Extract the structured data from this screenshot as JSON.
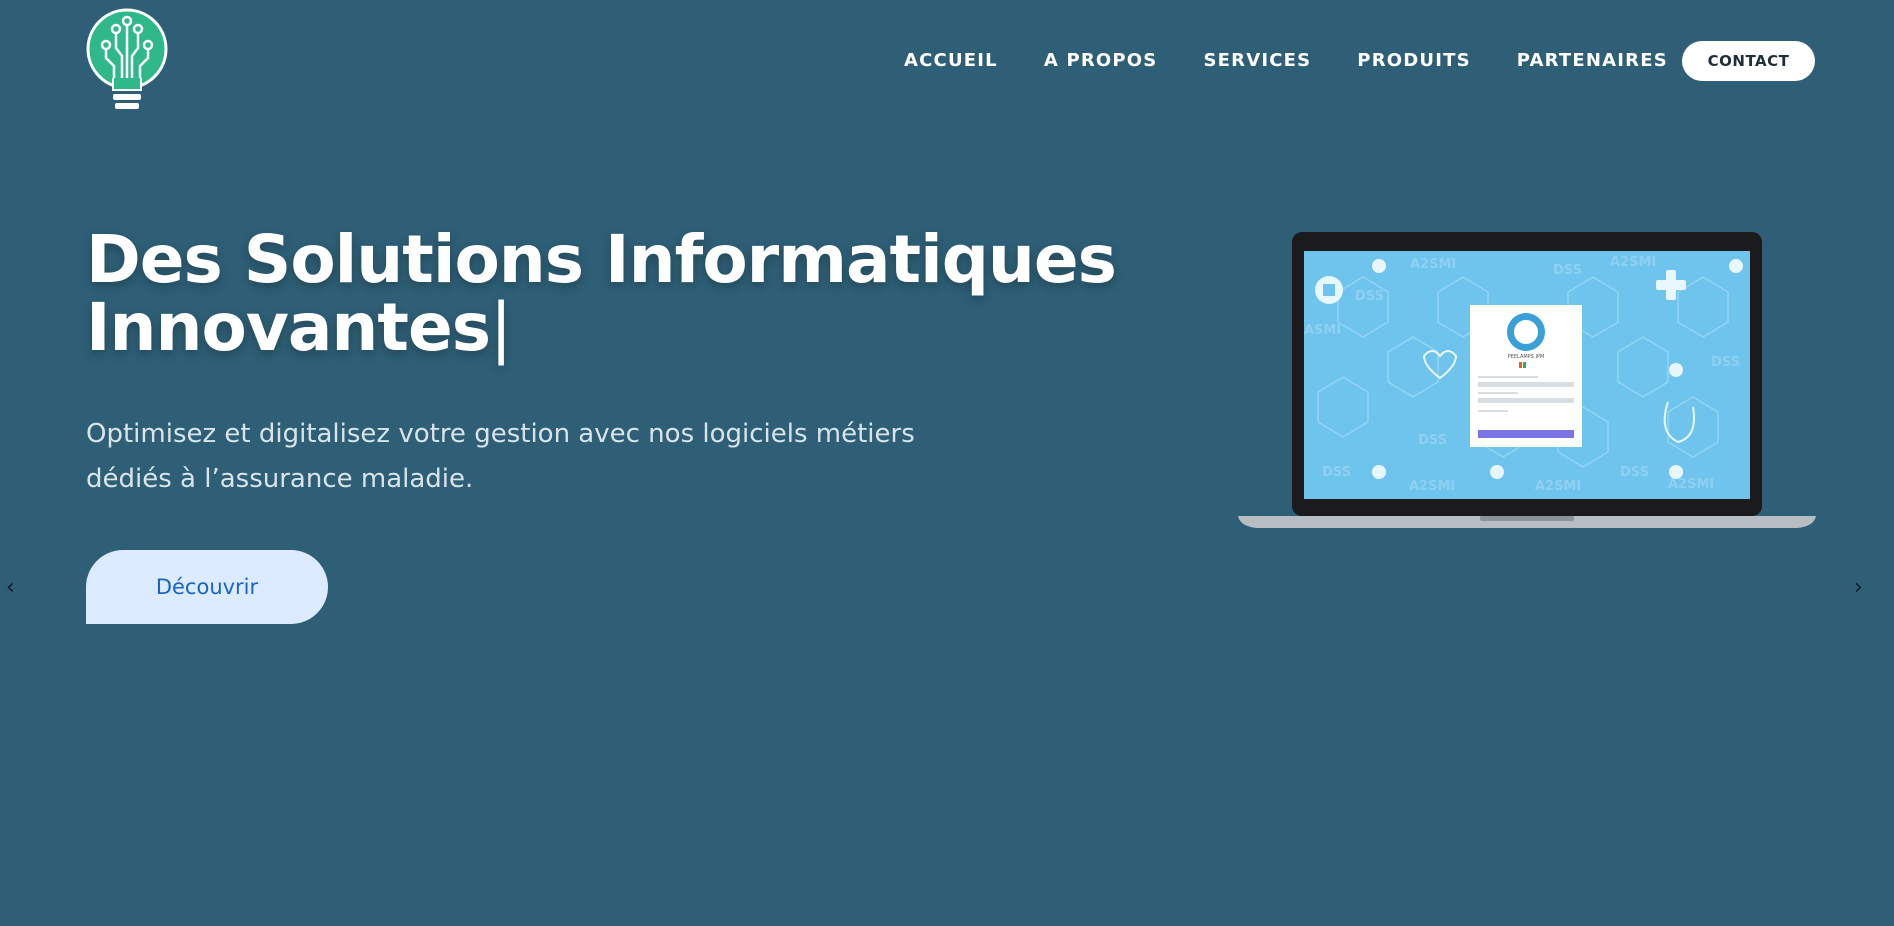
{
  "nav": {
    "items": [
      "ACCUEIL",
      "A PROPOS",
      "SERVICES",
      "PRODUITS",
      "PARTENAIRES"
    ],
    "contact_label": "CONTACT"
  },
  "hero": {
    "title_line1": "Des Solutions Informatiques",
    "title_line2": "Innovantes",
    "cursor": "|",
    "subtitle_line1": "Optimisez et digitalisez votre gestion avec nos logiciels métiers",
    "subtitle_line2": "dédiés à l’assurance maladie.",
    "cta_label": "Découvrir"
  },
  "carousel": {
    "prev_glyph": "‹",
    "next_glyph": "›"
  },
  "laptop_screen": {
    "watermarks": [
      "A2SMI",
      "DSS",
      "DSS",
      "A2SMI",
      "ASMI",
      "DSS",
      "DSS",
      "DSS",
      "A2SMI",
      "A2SMI",
      "DSS",
      "A2SMI"
    ],
    "login_title": "PEELAMPS IPM"
  },
  "colors": {
    "background": "#2e5f76",
    "cta_bg": "#dcebff",
    "cta_text": "#1a64c4",
    "logo_green": "#2fb88a"
  },
  "icons": [
    "bulb-logo-icon",
    "chevron-left-icon",
    "chevron-right-icon",
    "laptop-illustration"
  ]
}
